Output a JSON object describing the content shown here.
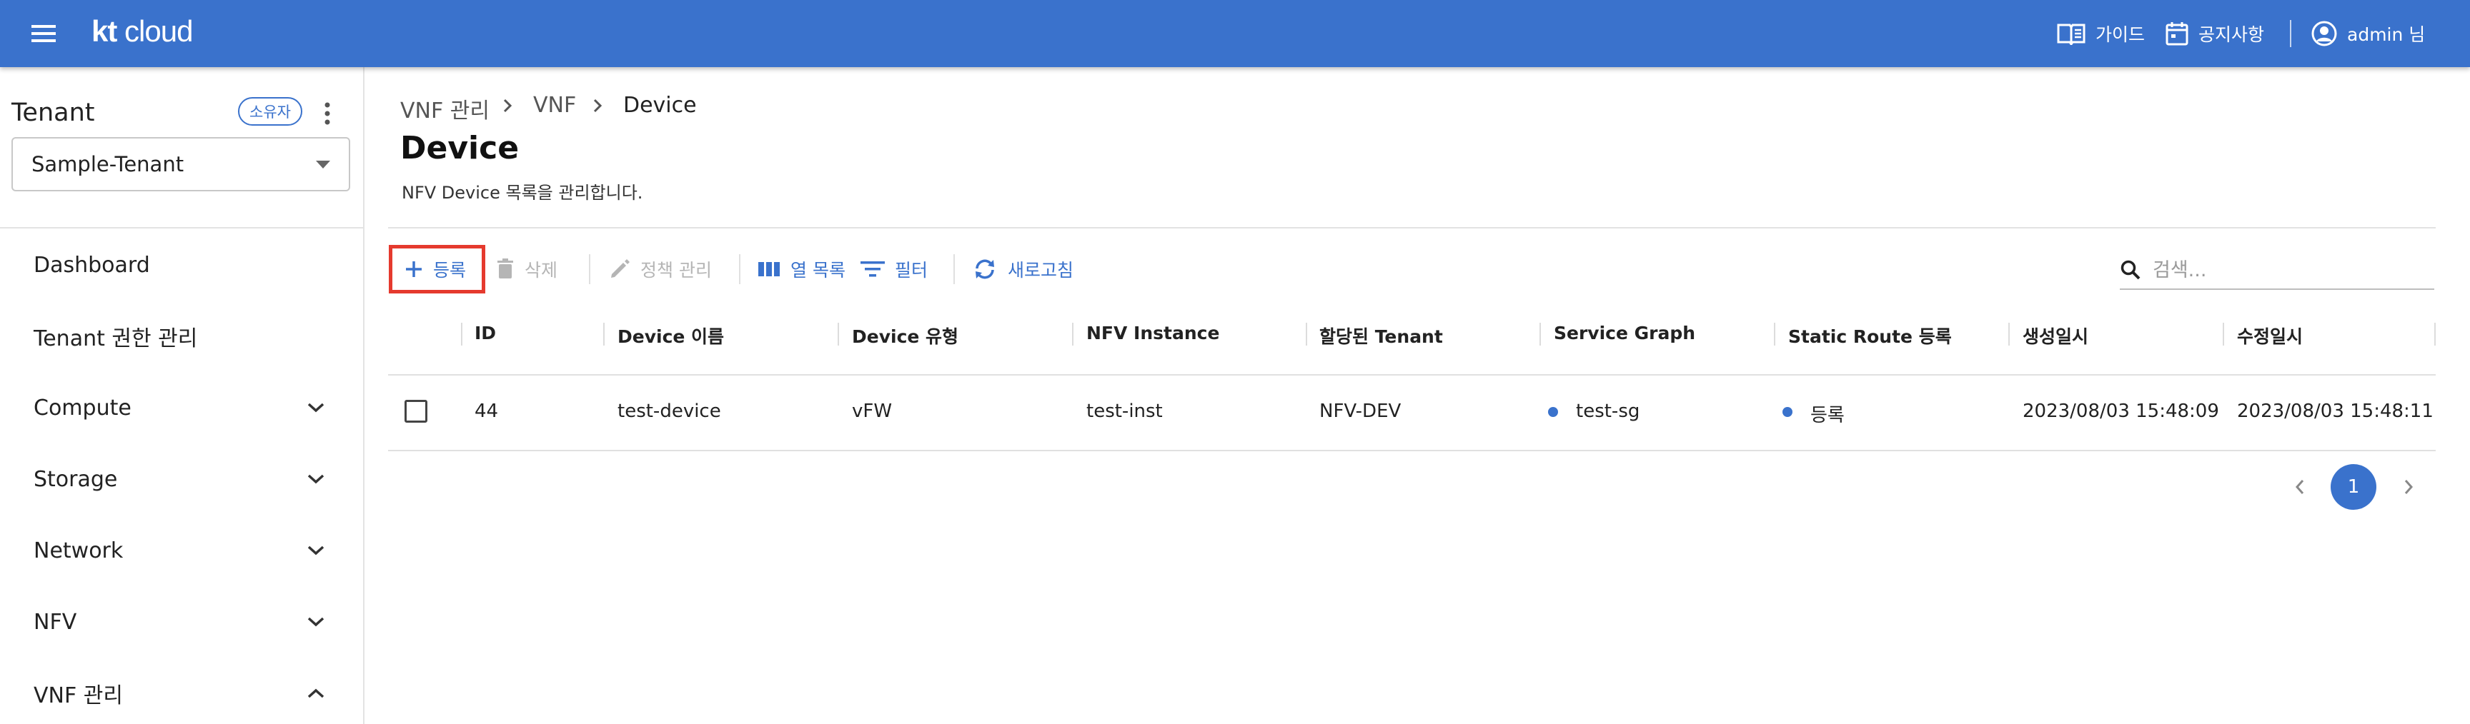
{
  "appbar": {
    "logo_bold": "kt",
    "logo_light": "cloud",
    "guide_label": "가이드",
    "notice_label": "공지사항",
    "user_label": "admin 님"
  },
  "sidebar": {
    "tenant_title": "Tenant",
    "owner_chip": "소유자",
    "tenant_selected": "Sample-Tenant",
    "items": [
      {
        "label": "Dashboard"
      },
      {
        "label": "Tenant 권한 관리"
      },
      {
        "label": "Compute"
      },
      {
        "label": "Storage"
      },
      {
        "label": "Network"
      },
      {
        "label": "NFV"
      },
      {
        "label": "VNF 관리"
      }
    ]
  },
  "breadcrumb": [
    "VNF 관리",
    "VNF",
    "Device"
  ],
  "page": {
    "title": "Device",
    "subtitle": "NFV Device 목록을 관리합니다."
  },
  "toolbar": {
    "register": "등록",
    "delete": "삭제",
    "policy": "정책 관리",
    "columns": "열 목록",
    "filter": "필터",
    "refresh": "새로고침",
    "search_placeholder": "검색..."
  },
  "table": {
    "headers": [
      "ID",
      "Device 이름",
      "Device 유형",
      "NFV Instance",
      "할당된 Tenant",
      "Service Graph",
      "Static Route 등록",
      "생성일시",
      "수정일시"
    ],
    "rows": [
      {
        "id": "44",
        "name": "test-device",
        "type": "vFW",
        "instance": "test-inst",
        "tenant": "NFV-DEV",
        "service_graph": "test-sg",
        "static_route": "등록",
        "created": "2023/08/03 15:48:09",
        "updated": "2023/08/03 15:48:11"
      }
    ]
  },
  "pagination": {
    "current": "1"
  },
  "colors": {
    "primary": "#3a72cc",
    "highlight": "#e53a2e"
  }
}
